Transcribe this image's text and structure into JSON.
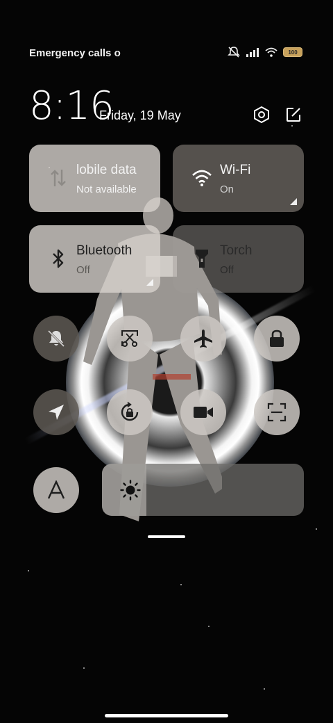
{
  "status_bar": {
    "carrier_text": "Emergency calls o",
    "battery_level": "100",
    "icons": [
      "silent-bell-icon",
      "signal-icon",
      "wifi-icon",
      "battery-icon"
    ]
  },
  "header": {
    "time": "8:16",
    "date": "Friday, 19 May",
    "settings_icon": "settings-hexagon-icon",
    "edit_icon": "edit-icon"
  },
  "tiles": {
    "mobile_data": {
      "label": "lobile data",
      "sub": "Not available",
      "icon": "mobile-data-arrows-icon",
      "active": false
    },
    "wifi": {
      "label": "Wi-Fi",
      "sub": "On",
      "icon": "wifi-icon",
      "active": true
    },
    "bluetooth": {
      "label": "Bluetooth",
      "sub": "Off",
      "icon": "bluetooth-icon",
      "active": false
    },
    "torch": {
      "label": "Torch",
      "sub": "Off",
      "icon": "torch-icon",
      "active": false
    }
  },
  "toggles": [
    {
      "name": "mute",
      "icon": "bell-off-icon",
      "active": true
    },
    {
      "name": "screenshot",
      "icon": "scissors-icon",
      "active": false
    },
    {
      "name": "airplane",
      "icon": "airplane-icon",
      "active": false
    },
    {
      "name": "lock",
      "icon": "lock-icon",
      "active": false
    },
    {
      "name": "location",
      "icon": "location-arrow-icon",
      "active": true
    },
    {
      "name": "rotation-lock",
      "icon": "rotation-lock-icon",
      "active": false
    },
    {
      "name": "screen-record",
      "icon": "video-camera-icon",
      "active": false
    },
    {
      "name": "scanner",
      "icon": "scan-icon",
      "active": false
    },
    {
      "name": "auto-brightness",
      "icon": "letter-a-icon",
      "active": false
    }
  ],
  "brightness": {
    "level": 0.22,
    "icon": "sun-icon"
  },
  "colors": {
    "tile_light": "#d7d2cd",
    "tile_dark": "#645f5a",
    "battery": "#c8a25c"
  }
}
